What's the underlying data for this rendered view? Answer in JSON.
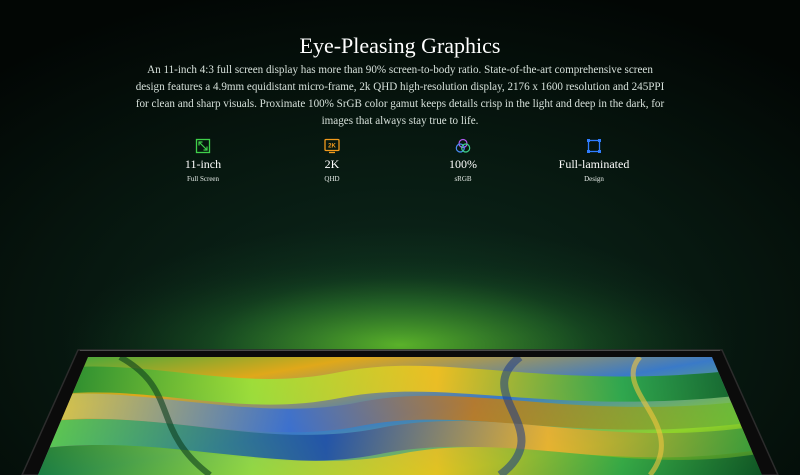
{
  "section": {
    "title": "Eye-Pleasing Graphics",
    "description": "An 11-inch 4:3 full screen display has more than 90% screen-to-body ratio. State-of-the-art comprehensive screen design features a 4.9mm equidistant micro-frame, 2k QHD high-resolution display, 2176 x 1600 resolution and 245PPI for clean and sharp visuals. Proximate 100% SrGB color gamut keeps details crisp in the light and deep in the dark, for images that always stay true to life."
  },
  "features": [
    {
      "icon": "full-screen-icon",
      "value": "11-inch",
      "label": "Full Screen",
      "color": "#3fcf4a"
    },
    {
      "icon": "2k-icon",
      "badge": "2K",
      "value": "2K",
      "label": "QHD",
      "color": "#f29a1c"
    },
    {
      "icon": "srgb-icon",
      "value": "100%",
      "label": "sRGB",
      "color": "#8a5cf0"
    },
    {
      "icon": "full-laminated-icon",
      "value": "Full-laminated",
      "label": "Design",
      "color": "#2f7dff"
    }
  ],
  "colors": {
    "background": "#071810",
    "glow": "#4a9a2a",
    "tablet_bezel": "#0b0b0b"
  }
}
